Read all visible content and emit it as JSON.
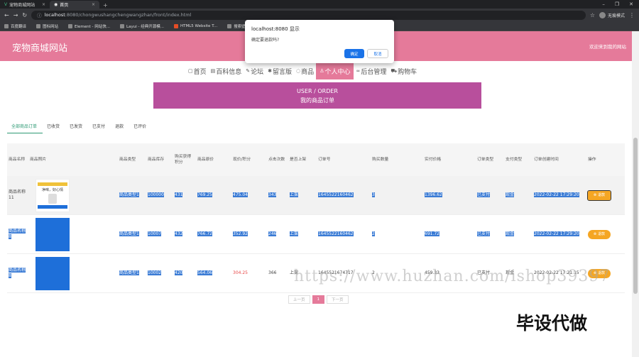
{
  "browser": {
    "tabs": [
      {
        "label": "宠物商城网站"
      },
      {
        "label": "首页"
      }
    ],
    "new_tab": "+",
    "url_host": "localhost",
    "url_rest": ":8080/chongwushangchengwangzhan/front/index.html",
    "incognito": "无痕模式",
    "bookmarks": [
      "百度翻译",
      "图标网站",
      "Element - 网站快...",
      "Layui - 经典开源模...",
      "HTML5 Website T...",
      "搜索壁纸"
    ]
  },
  "header": {
    "title": "宠物商城网站",
    "welcome": "欢迎来到我的网站"
  },
  "nav": [
    {
      "label": "首页",
      "icon": "▢"
    },
    {
      "label": "百科信息",
      "icon": "▤"
    },
    {
      "label": "论坛",
      "icon": "✎"
    },
    {
      "label": "留言版",
      "icon": "✱"
    },
    {
      "label": "商品",
      "icon": "◌"
    },
    {
      "label": "个人中心",
      "icon": "♙"
    },
    {
      "label": "后台管理",
      "icon": "∞"
    },
    {
      "label": "购物车",
      "icon": "⛟"
    }
  ],
  "banner": {
    "line1": "USER / ORDER",
    "line2": "我的商品订单"
  },
  "subtabs": [
    "全部商品订单",
    "已收货",
    "已发货",
    "已支付",
    "退款",
    "已评价"
  ],
  "table": {
    "headers": [
      "商品名称",
      "商品照片",
      "商品类型",
      "商品库存",
      "购买获得积分",
      "商品原价",
      "现价/积分",
      "点击次数",
      "是否上架",
      "订单号",
      "购买数量",
      "实付价格",
      "订单类型",
      "支付类型",
      "订单创建时间",
      "操作"
    ],
    "rows": [
      {
        "name": "商品名称11",
        "type": "商品类型1",
        "stock": "100000",
        "points": "431",
        "orig": "769.25",
        "price": "475.04",
        "clicks": "343",
        "onsale": "上架",
        "order_no": "1645522160462",
        "qty": "3",
        "paid": "1396.62",
        "otype": "已支付",
        "ptype": "现金",
        "time": "2022-02-22 17:29:20",
        "action": "退款",
        "img_caption": "净味，好心情"
      },
      {
        "name": "商品名称8",
        "type": "商品类型1",
        "stock": "10007",
        "points": "432",
        "orig": "766.72",
        "price": "352.92",
        "clicks": "246",
        "onsale": "上架",
        "order_no": "1645522160462",
        "qty": "2",
        "paid": "691.72",
        "otype": "已支付",
        "ptype": "现金",
        "time": "2022-02-22 17:29:20",
        "action": "退款"
      },
      {
        "name": "商品名称8",
        "type": "商品类型1",
        "stock": "10002",
        "points": "420",
        "orig": "564.06",
        "price": "304.25",
        "clicks": "366",
        "onsale": "上架",
        "order_no": "1645521674717",
        "qty": "2",
        "paid": "459.33",
        "otype": "已支付",
        "ptype": "现金",
        "time": "2022-02-22 17:21:15",
        "action": "退款"
      }
    ]
  },
  "pager": {
    "prev": "上一页",
    "current": "1",
    "next": "下一页"
  },
  "watermark": "https://www.huzhan.com/ishop39397",
  "watermark2": "毕设代做",
  "dialog": {
    "title": "localhost:8080 显示",
    "message": "确定要退款吗?",
    "ok": "确定",
    "cancel": "取消"
  },
  "colors": {
    "brand": "#e57a9a",
    "banner": "#b84f9c",
    "accent_green": "#2d9a74",
    "refund": "#f5a623"
  }
}
